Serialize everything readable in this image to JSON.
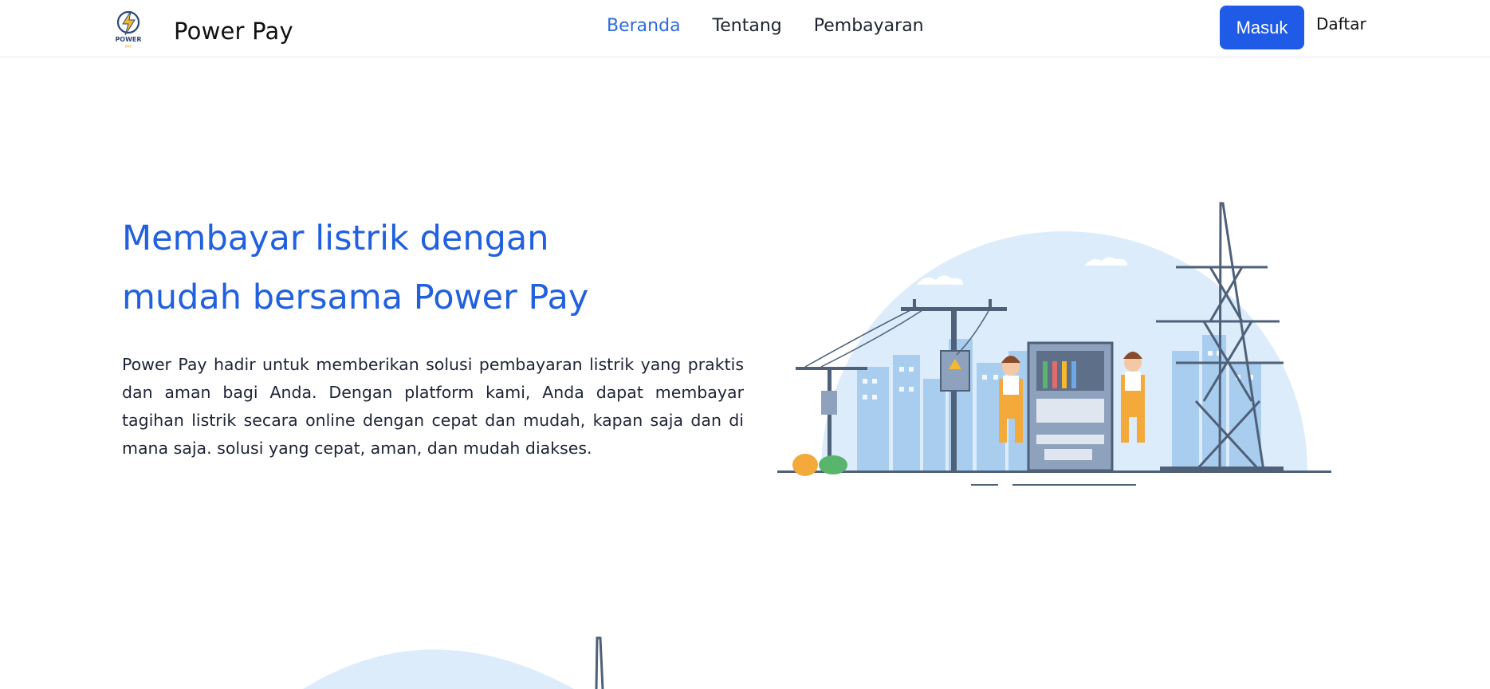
{
  "brand": {
    "name": "Power Pay",
    "logo_text": "POWER",
    "logo_subtext": "PAY"
  },
  "nav": {
    "links": [
      {
        "label": "Beranda",
        "active": true
      },
      {
        "label": "Tentang",
        "active": false
      },
      {
        "label": "Pembayaran",
        "active": false
      }
    ],
    "login_label": "Masuk",
    "register_label": "Daftar"
  },
  "hero": {
    "title_line1": "Membayar listrik dengan",
    "title_line2": "mudah bersama Power Pay",
    "description": "Power Pay hadir untuk memberikan solusi pembayaran listrik yang praktis dan aman bagi Anda. Dengan platform kami, Anda dapat membayar tagihan listrik secara online dengan cepat dan mudah, kapan saja dan di mana saja. solusi yang cepat, aman, dan mudah diakses."
  },
  "colors": {
    "accent": "#1f5be6",
    "title": "#2160de",
    "illustration_bg": "#dcecfb",
    "worker_orange": "#f4a93b",
    "steel": "#4f6079"
  },
  "icons": [
    "lightning-logo-icon"
  ]
}
